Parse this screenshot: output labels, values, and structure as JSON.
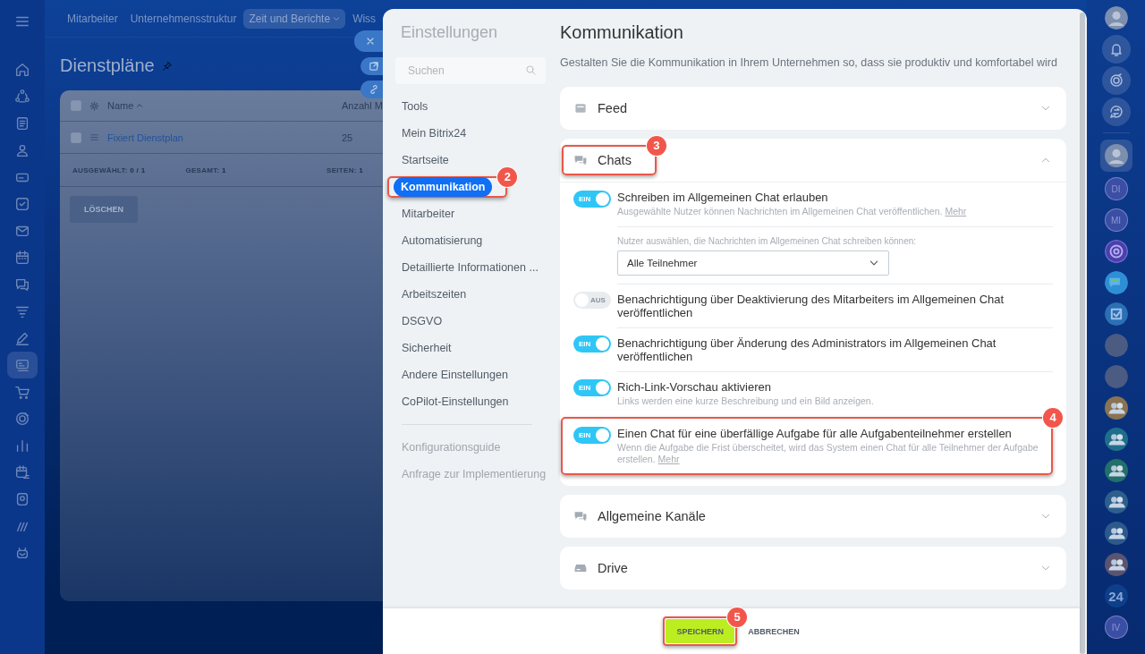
{
  "left_rail": {
    "items": [
      {
        "kind": "home",
        "selected": false
      },
      {
        "kind": "flow",
        "selected": false
      },
      {
        "kind": "document",
        "selected": false
      },
      {
        "kind": "people",
        "selected": false
      },
      {
        "kind": "card",
        "selected": false
      },
      {
        "kind": "check",
        "selected": false
      },
      {
        "kind": "mail",
        "selected": false
      },
      {
        "kind": "calendar",
        "selected": false
      },
      {
        "kind": "chat",
        "selected": false
      },
      {
        "kind": "filter",
        "selected": false
      },
      {
        "kind": "pen",
        "selected": false
      },
      {
        "kind": "cards",
        "selected": true
      },
      {
        "kind": "cart",
        "selected": false
      },
      {
        "kind": "target",
        "selected": false
      },
      {
        "kind": "chart",
        "selected": false
      },
      {
        "kind": "calendar-list",
        "selected": false
      },
      {
        "kind": "camera",
        "selected": false
      },
      {
        "kind": "stripes",
        "selected": false
      },
      {
        "kind": "robot",
        "selected": false
      }
    ]
  },
  "top_nav": {
    "items": [
      {
        "label": "Mitarbeiter",
        "selected": false,
        "has_caret": false
      },
      {
        "label": "Unternehmensstruktur",
        "selected": false,
        "has_caret": false
      },
      {
        "label": "Zeit und Berichte",
        "selected": true,
        "has_caret": true
      },
      {
        "label": "Wiss",
        "selected": false,
        "has_caret": false
      }
    ]
  },
  "page": {
    "title": "Dienstpläne",
    "grid": {
      "select_all_checked": false,
      "columns": [
        "Name",
        "Anzahl M"
      ],
      "rows": [
        {
          "checked": false,
          "cells": [
            "Fixiert Dienstplan",
            "25"
          ]
        }
      ],
      "footer": [
        {
          "label": "AUSGEWÄHLT:",
          "value": "0 / 1"
        },
        {
          "label": "GESAMT:",
          "value": "1"
        },
        {
          "label": "SEITEN:",
          "value": "1"
        }
      ],
      "delete_button": "LÖSCHEN"
    }
  },
  "settings": {
    "title": "Einstellungen",
    "search": {
      "placeholder": "Suchen"
    },
    "nav": [
      {
        "label": "Tools",
        "selected": false
      },
      {
        "label": "Mein Bitrix24",
        "selected": false
      },
      {
        "label": "Startseite",
        "selected": false
      },
      {
        "label": "Kommunikation",
        "selected": true,
        "callout": "2"
      },
      {
        "label": "Mitarbeiter",
        "selected": false
      },
      {
        "label": "Automatisierung",
        "selected": false
      },
      {
        "label": "Detaillierte Informationen ...",
        "selected": false
      },
      {
        "label": "Arbeitszeiten",
        "selected": false
      },
      {
        "label": "DSGVO",
        "selected": false
      },
      {
        "label": "Sicherheit",
        "selected": false
      },
      {
        "label": "Andere Einstellungen",
        "selected": false
      },
      {
        "label": "CoPilot-Einstellungen",
        "selected": false
      }
    ],
    "links": [
      "Konfigurationsguide",
      "Anfrage zur Implementierung"
    ]
  },
  "content": {
    "title": "Kommunikation",
    "description": "Gestalten Sie die Kommunikation in Ihrem Unternehmen so, dass sie produktiv und komfortabel wird",
    "sections": [
      {
        "title": "Feed",
        "kind": "feed",
        "expanded": false
      },
      {
        "title": "Chats",
        "kind": "chats",
        "expanded": true,
        "callout": "3",
        "options": [
          {
            "on": true,
            "toggle_label": "EIN",
            "title": "Schreiben im Allgemeinen Chat erlauben",
            "description": "Ausgewählte Nutzer können Nachrichten im Allgemeinen Chat veröffentlichen.",
            "link": "Mehr",
            "select": {
              "label": "Nutzer auswählen, die Nachrichten im Allgemeinen Chat schreiben können:",
              "value": "Alle Teilnehmer"
            }
          },
          {
            "on": false,
            "toggle_label": "AUS",
            "title": "Benachrichtigung über Deaktivierung des Mitarbeiters im Allgemeinen Chat veröffentlichen"
          },
          {
            "on": true,
            "toggle_label": "EIN",
            "title": "Benachrichtigung über Änderung des Administrators im Allgemeinen Chat veröffentlichen"
          },
          {
            "on": true,
            "toggle_label": "EIN",
            "title": "Rich-Link-Vorschau aktivieren",
            "description": "Links werden eine kurze Beschreibung und ein Bild anzeigen."
          },
          {
            "on": true,
            "toggle_label": "EIN",
            "title": "Einen Chat für eine überfällige Aufgabe für alle Aufgabenteilnehmer erstellen",
            "description": "Wenn die Aufgabe die Frist überscheitet, wird das System einen Chat für alle Teilnehmer der Aufgabe erstellen.",
            "link": "Mehr",
            "callout": "4"
          }
        ]
      },
      {
        "title": "Allgemeine Kanäle",
        "kind": "chats",
        "expanded": false
      },
      {
        "title": "Drive",
        "kind": "drive",
        "expanded": false
      }
    ]
  },
  "footer": {
    "save": {
      "label": "SPEICHERN",
      "callout": "5"
    },
    "cancel": "ABBRECHEN"
  },
  "right_rail": {
    "top_items": [
      {
        "kind": "avatar",
        "selected": false
      },
      {
        "kind": "bell",
        "selected": false
      },
      {
        "kind": "target",
        "selected": false
      },
      {
        "kind": "chat-sync",
        "selected": false
      }
    ],
    "chat_items": [
      {
        "kind": "avatar",
        "selected": true
      },
      {
        "kind": "initials",
        "text": "DI",
        "selected": false
      },
      {
        "kind": "initials",
        "text": "MI",
        "selected": false
      },
      {
        "kind": "target-app",
        "selected": false
      },
      {
        "kind": "chat-app",
        "selected": false
      },
      {
        "kind": "check-app",
        "selected": false
      },
      {
        "kind": "photo",
        "selected": false
      },
      {
        "kind": "photo",
        "selected": false
      },
      {
        "kind": "group",
        "color": "#8a7352",
        "selected": false
      },
      {
        "kind": "group",
        "color": "#1f6f8b",
        "selected": false
      },
      {
        "kind": "group",
        "color": "#22706a",
        "selected": false
      },
      {
        "kind": "group",
        "color": "#2d5f8e",
        "selected": false
      },
      {
        "kind": "group",
        "color": "#2d5a8c",
        "selected": false
      },
      {
        "kind": "group",
        "color": "#5a5470",
        "selected": false
      },
      {
        "kind": "number",
        "text": "24",
        "selected": false
      },
      {
        "kind": "initials",
        "text": "IV",
        "selected": false
      }
    ]
  }
}
